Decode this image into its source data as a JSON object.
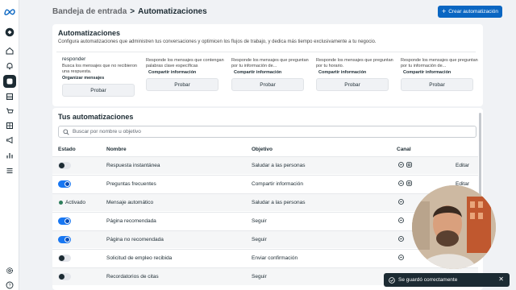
{
  "breadcrumb": {
    "parent": "Bandeja de entrada",
    "separator": ">",
    "current": "Automatizaciones"
  },
  "create_button": {
    "icon": "plus-icon",
    "label": "Crear automatización"
  },
  "templates": {
    "title": "Automatizaciones",
    "description": "Configura automatizaciones que administren tus conversaciones y optimicen los flujos de trabajo, y dedica más tiempo exclusivamente a tu negocio.",
    "items": [
      {
        "name": "responder",
        "desc": "Busca los mensajes que no recibieron una respuesta.",
        "tag": "Organizar mensajes",
        "button": "Probar"
      },
      {
        "name": "",
        "desc": "Responde los mensajes que contengan palabras clave específicas",
        "tag": "Compartir información",
        "button": "Probar"
      },
      {
        "name": "",
        "desc": "Responde los mensajes que preguntan por tu información de...",
        "tag": "Compartir información",
        "button": "Probar"
      },
      {
        "name": "",
        "desc": "Responde los mensajes que preguntan por tu horario.",
        "tag": "Compartir información",
        "button": "Probar"
      },
      {
        "name": "",
        "desc": "Responde los mensajes que preguntan por tu información de...",
        "tag": "Compartir información",
        "button": "Probar"
      }
    ]
  },
  "automations": {
    "title": "Tus automatizaciones",
    "search_placeholder": "Buscar por nombre u objetivo",
    "columns": {
      "estado": "Estado",
      "nombre": "Nombre",
      "objetivo": "Objetivo",
      "canal": "Canal"
    },
    "rows": [
      {
        "state": "off",
        "state_label": "",
        "name": "Respuesta instantánea",
        "goal": "Saludar a las personas",
        "channels": [
          "messenger-icon",
          "instagram-icon"
        ],
        "action": "Editar"
      },
      {
        "state": "on",
        "state_label": "",
        "name": "Preguntas frecuentes",
        "goal": "Compartir información",
        "channels": [
          "messenger-icon",
          "instagram-icon"
        ],
        "action": "Editar"
      },
      {
        "state": "active",
        "state_label": "Activado",
        "name": "Mensaje automático",
        "goal": "Saludar a las personas",
        "channels": [
          "messenger-icon"
        ],
        "action": ""
      },
      {
        "state": "on",
        "state_label": "",
        "name": "Página recomendada",
        "goal": "Seguir",
        "channels": [
          "messenger-icon"
        ],
        "action": ""
      },
      {
        "state": "on",
        "state_label": "",
        "name": "Página no recomendada",
        "goal": "Seguir",
        "channels": [
          "messenger-icon"
        ],
        "action": ""
      },
      {
        "state": "off",
        "state_label": "",
        "name": "Solicitud de empleo recibida",
        "goal": "Enviar confirmación",
        "channels": [
          "messenger-icon"
        ],
        "action": ""
      },
      {
        "state": "off",
        "state_label": "",
        "name": "Recordatorios de citas",
        "goal": "Seguir",
        "channels": [
          "messenger-icon"
        ],
        "action": ""
      }
    ]
  },
  "toast": {
    "icon": "check-circle-icon",
    "message": "Se guardó correctamente",
    "close_icon": "close-icon"
  },
  "colors": {
    "primary": "#0a66c2",
    "toggle_on": "#1877f2",
    "dark": "#1c2b33",
    "active_green": "#2e7d5b"
  }
}
